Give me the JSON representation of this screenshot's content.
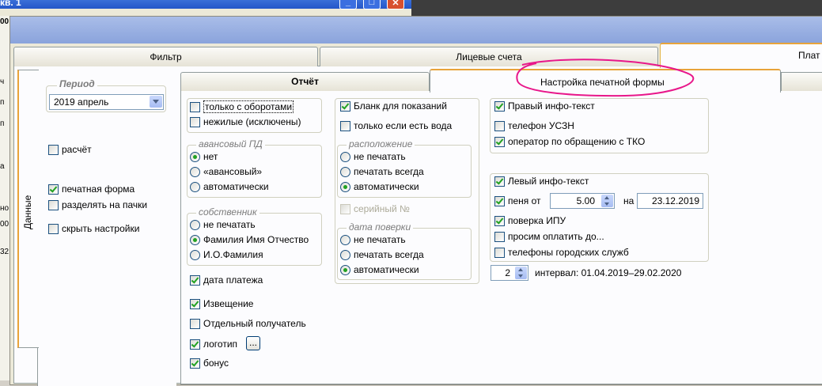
{
  "background": {
    "title_fragment": "кв. 1",
    "strip_items": [
      "00",
      "ч",
      "п",
      "п",
      "а",
      "но",
      "00",
      "32"
    ]
  },
  "tabs_top": {
    "filter": "Фильтр",
    "accounts": "Лицевые счета",
    "payments": "Плат"
  },
  "side_tab": {
    "label": "Данные"
  },
  "left": {
    "period_legend": "Период",
    "period_value": "2019 апрель",
    "calc": {
      "label": "расчёт",
      "checked": false
    },
    "print_form": {
      "label": "печатная форма",
      "checked": true
    },
    "split_packs": {
      "label": "разделять на пачки",
      "checked": false
    },
    "hide_settings": {
      "label": "скрыть настройки",
      "checked": false
    }
  },
  "inner_tabs": {
    "report": "Отчёт",
    "print_settings": "Настройка печатной формы"
  },
  "col1": {
    "with_turnover": {
      "label": "только с оборотами",
      "checked": false
    },
    "non_residential": {
      "label": "нежилые (исключены)",
      "checked": false
    },
    "advance_legend": "авансовый ПД",
    "advance_options": [
      "нет",
      "«авансовый»",
      "автоматически"
    ],
    "advance_selected": 0,
    "owner_legend": "собственник",
    "owner_options": [
      "не печатать",
      "Фамилия Имя Отчество",
      "И.О.Фамилия"
    ],
    "owner_selected": 1,
    "pay_date": {
      "label": "дата платежа",
      "checked": true
    },
    "notice": {
      "label": "Извещение",
      "checked": true
    },
    "separate_recipient": {
      "label": "Отдельный получатель",
      "checked": false
    },
    "logo": {
      "label": "логотип",
      "checked": true,
      "button": "..."
    },
    "bonus": {
      "label": "бонус",
      "checked": true
    }
  },
  "col2": {
    "readings_form": {
      "label": "Бланк для показаний",
      "checked": true
    },
    "only_water": {
      "label": "только если есть вода",
      "checked": false
    },
    "placement_legend": "расположение",
    "placement_options": [
      "не печатать",
      "печатать всегда",
      "автоматически"
    ],
    "placement_selected": 2,
    "serial": {
      "label": "серийный №",
      "checked": false
    },
    "verification_legend": "дата поверки",
    "verification_options": [
      "не печатать",
      "печатать всегда",
      "автоматически"
    ],
    "verification_selected": 2
  },
  "col3": {
    "right_info": {
      "label": "Правый инфо-текст",
      "checked": true
    },
    "uszn_phone": {
      "label": "телефон УСЗН",
      "checked": false
    },
    "tko_operator": {
      "label": "оператор по обращению с ТКО",
      "checked": true
    },
    "left_info": {
      "label": "Левый инфо-текст",
      "checked": true
    },
    "penalty": {
      "label": "пеня от",
      "checked": true,
      "value": "5.00",
      "on_label": "на",
      "date": "23.12.2019"
    },
    "ipu_check": {
      "label": "поверка ИПУ",
      "checked": true
    },
    "please_pay": {
      "label": "просим оплатить до...",
      "checked": false
    },
    "city_phones": {
      "label": "телефоны городских служб",
      "checked": false
    },
    "interval_count": "2",
    "interval_text": "интервал: 01.04.2019–29.02.2020"
  },
  "colors": {
    "annotation": "#e8178a",
    "tab_accent": "#e8a33a",
    "check": "#21a121"
  }
}
